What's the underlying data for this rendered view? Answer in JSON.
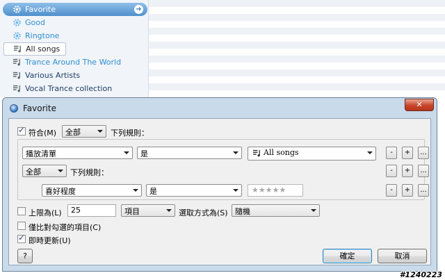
{
  "sidebar": {
    "items": [
      {
        "label": "Favorite",
        "icon": "gear-icon"
      },
      {
        "label": "Good",
        "icon": "gear-icon"
      },
      {
        "label": "Ringtone",
        "icon": "gear-icon"
      },
      {
        "label": "All songs",
        "icon": "playlist-icon"
      },
      {
        "label": "Trance Around The World",
        "icon": "playlist-icon"
      },
      {
        "label": "Various Artists",
        "icon": "playlist-icon"
      },
      {
        "label": "Vocal Trance collection",
        "icon": "playlist-icon"
      }
    ],
    "go_glyph": "➜"
  },
  "dialog": {
    "title": "Favorite",
    "close_label": "✕",
    "match": {
      "label": "符合(M)",
      "checked": true,
      "value": "全部",
      "suffix": "下列規則："
    },
    "rule1": {
      "field": "播放清單",
      "operator": "是",
      "value": "All songs"
    },
    "group": {
      "value": "全部",
      "suffix": "下列規則："
    },
    "rule2": {
      "field": "喜好程度",
      "operator": "是",
      "stars": "★★★★★"
    },
    "buttons": {
      "minus": "-",
      "plus": "+",
      "more": "..."
    },
    "limit": {
      "label": "上限為(L)",
      "checked": false,
      "value": "25",
      "unit": "項目",
      "select_label": "選取方式為(S)",
      "select_value": "隨機"
    },
    "checked_only": {
      "label": "僅比對勾選的項目(C)",
      "checked": false
    },
    "live_update": {
      "label": "即時更新(U)",
      "checked": true
    },
    "help_label": "?",
    "ok_label": "確定",
    "cancel_label": "取消"
  },
  "watermark": "#1240223",
  "colors": {
    "accent": "#2e8fd0",
    "close": "#c7452a",
    "frame": "#c9daea"
  }
}
